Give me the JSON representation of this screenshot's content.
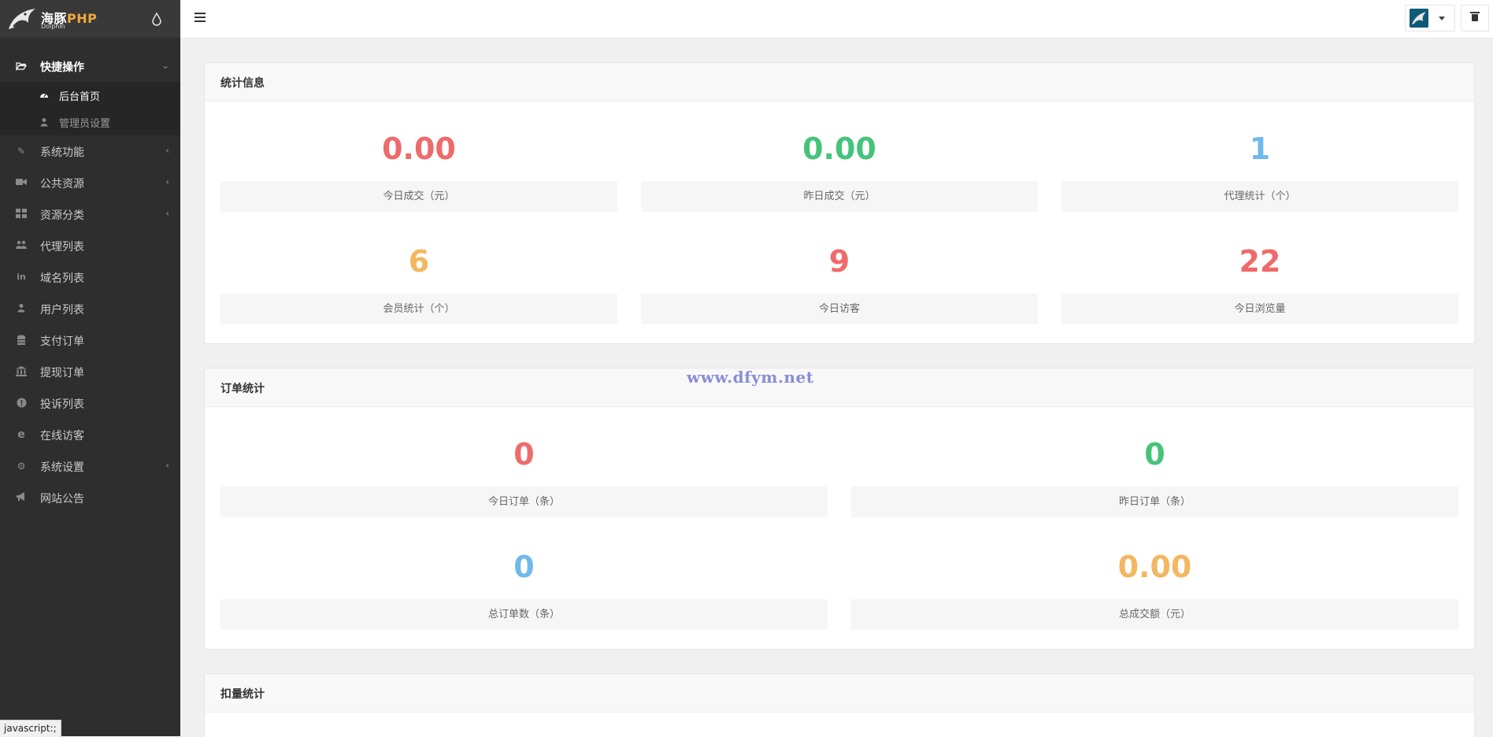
{
  "brand": {
    "name_main": "海豚",
    "name_php": "PHP",
    "sub": "Dolphin"
  },
  "sidebar": {
    "group": {
      "label": "快捷操作",
      "icon": "folder-open-icon"
    },
    "sub_items": [
      {
        "label": "后台首页",
        "icon": "dashboard-icon",
        "active": true
      },
      {
        "label": "管理员设置",
        "icon": "user-icon",
        "active": false
      }
    ],
    "items": [
      {
        "label": "系统功能",
        "icon": "wrench-icon",
        "has_children": true
      },
      {
        "label": "公共资源",
        "icon": "video-camera-icon",
        "has_children": true
      },
      {
        "label": "资源分类",
        "icon": "grid-icon",
        "has_children": true
      },
      {
        "label": "代理列表",
        "icon": "users-icon",
        "has_children": false
      },
      {
        "label": "域名列表",
        "icon": "linkedin-icon",
        "has_children": false
      },
      {
        "label": "用户列表",
        "icon": "user-icon",
        "has_children": false
      },
      {
        "label": "支付订单",
        "icon": "database-icon",
        "has_children": false
      },
      {
        "label": "提现订单",
        "icon": "bank-icon",
        "has_children": false
      },
      {
        "label": "投诉列表",
        "icon": "exclamation-circle-icon",
        "has_children": false
      },
      {
        "label": "在线访客",
        "icon": "edge-icon",
        "has_children": false
      },
      {
        "label": "系统设置",
        "icon": "gear-icon",
        "has_children": true
      },
      {
        "label": "网站公告",
        "icon": "bullhorn-icon",
        "has_children": false
      }
    ]
  },
  "status_bar": {
    "text": "javascript:;"
  },
  "panels": {
    "stats": {
      "title": "统计信息",
      "cards": [
        {
          "value": "0.00",
          "label": "今日成交（元）",
          "color": "#ef6b6b"
        },
        {
          "value": "0.00",
          "label": "昨日成交（元）",
          "color": "#46c37b"
        },
        {
          "value": "1",
          "label": "代理统计（个）",
          "color": "#70b9eb"
        },
        {
          "value": "6",
          "label": "会员统计（个）",
          "color": "#f3b760"
        },
        {
          "value": "9",
          "label": "今日访客",
          "color": "#ef6b6b"
        },
        {
          "value": "22",
          "label": "今日浏览量",
          "color": "#ef6b6b"
        }
      ]
    },
    "orders": {
      "title": "订单统计",
      "cards": [
        {
          "value": "0",
          "label": "今日订单（条）",
          "color": "#ef6b6b"
        },
        {
          "value": "0",
          "label": "昨日订单（条）",
          "color": "#46c37b"
        },
        {
          "value": "0",
          "label": "总订单数（条）",
          "color": "#70b9eb"
        },
        {
          "value": "0.00",
          "label": "总成交额（元）",
          "color": "#f3b760"
        }
      ]
    },
    "deduct": {
      "title": "扣量统计"
    }
  },
  "watermark": "www.dfym.net"
}
